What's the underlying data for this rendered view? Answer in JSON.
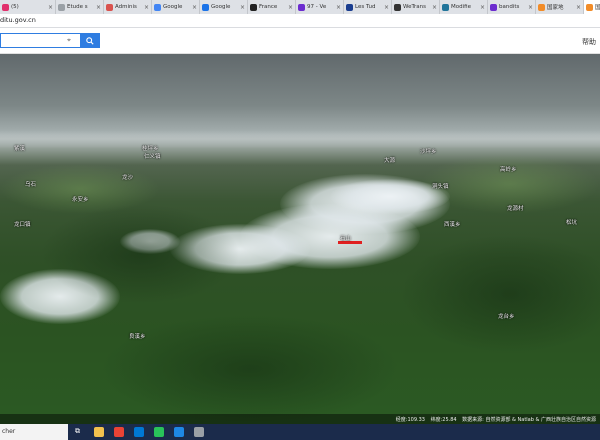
{
  "browser": {
    "tabs": [
      {
        "title": "(5)",
        "favicon_color": "#e1306c",
        "active": false
      },
      {
        "title": "Étude s",
        "favicon_color": "#9aa0a6",
        "active": false
      },
      {
        "title": "Adminis",
        "favicon_color": "#d9534f",
        "active": false
      },
      {
        "title": "Google",
        "favicon_color": "#4285f4",
        "active": false
      },
      {
        "title": "Google",
        "favicon_color": "#1a73e8",
        "active": false
      },
      {
        "title": "France",
        "favicon_color": "#222222",
        "active": false
      },
      {
        "title": "97 - Ve",
        "favicon_color": "#6c2ccf",
        "active": false
      },
      {
        "title": "Les Tud",
        "favicon_color": "#1a3d8f",
        "active": false
      },
      {
        "title": "WeTrans",
        "favicon_color": "#333333",
        "active": false
      },
      {
        "title": "Modifie",
        "favicon_color": "#21759b",
        "active": false
      },
      {
        "title": "bandits",
        "favicon_color": "#6c2ccf",
        "active": false
      },
      {
        "title": "国家地",
        "favicon_color": "#f28c28",
        "active": false
      },
      {
        "title": "国家地",
        "favicon_color": "#f28c28",
        "active": true
      }
    ],
    "tab_close_glyph": "×",
    "new_tab_glyph": "+",
    "url": "ditu.gov.cn"
  },
  "site": {
    "search_placeholder": "",
    "header_link": "帮助"
  },
  "map": {
    "places": [
      {
        "label": "紫溪",
        "class": "p1"
      },
      {
        "label": "桂坪乡",
        "class": "p2"
      },
      {
        "label": "仁义镇",
        "class": "p3"
      },
      {
        "label": "大源",
        "class": "p4"
      },
      {
        "label": "沙坪乡",
        "class": "p5"
      },
      {
        "label": "高岭乡",
        "class": "p6"
      },
      {
        "label": "乌石",
        "class": "p7"
      },
      {
        "label": "龙沙",
        "class": "p8"
      },
      {
        "label": "永安乡",
        "class": "p9"
      },
      {
        "label": "洞头镇",
        "class": "p10"
      },
      {
        "label": "龙口镇",
        "class": "p11"
      },
      {
        "label": "西溪乡",
        "class": "p12"
      },
      {
        "label": "龙源村",
        "class": "p13"
      },
      {
        "label": "松坑",
        "class": "p14"
      },
      {
        "label": "石山",
        "class": "p15"
      },
      {
        "label": "良溪乡",
        "class": "p16"
      },
      {
        "label": "龙台乡",
        "class": "p17"
      }
    ],
    "status": {
      "longitude": "经度:109.33",
      "latitude": "纬度:25.84",
      "source": "数据来源: 自然资源部 & Natlab & 广西壮族自治区自然资源"
    }
  },
  "taskbar": {
    "search_text": "cher",
    "task_view_glyph": "⧉",
    "app_colors": [
      "#f2c14e",
      "#ea4335",
      "#0078d4",
      "#29c35a",
      "#1e88e5",
      "#9aa0a6"
    ]
  },
  "colors": {
    "accent": "#2f7de1",
    "marker": "#e02020",
    "taskbar": "#1b2b4b"
  }
}
